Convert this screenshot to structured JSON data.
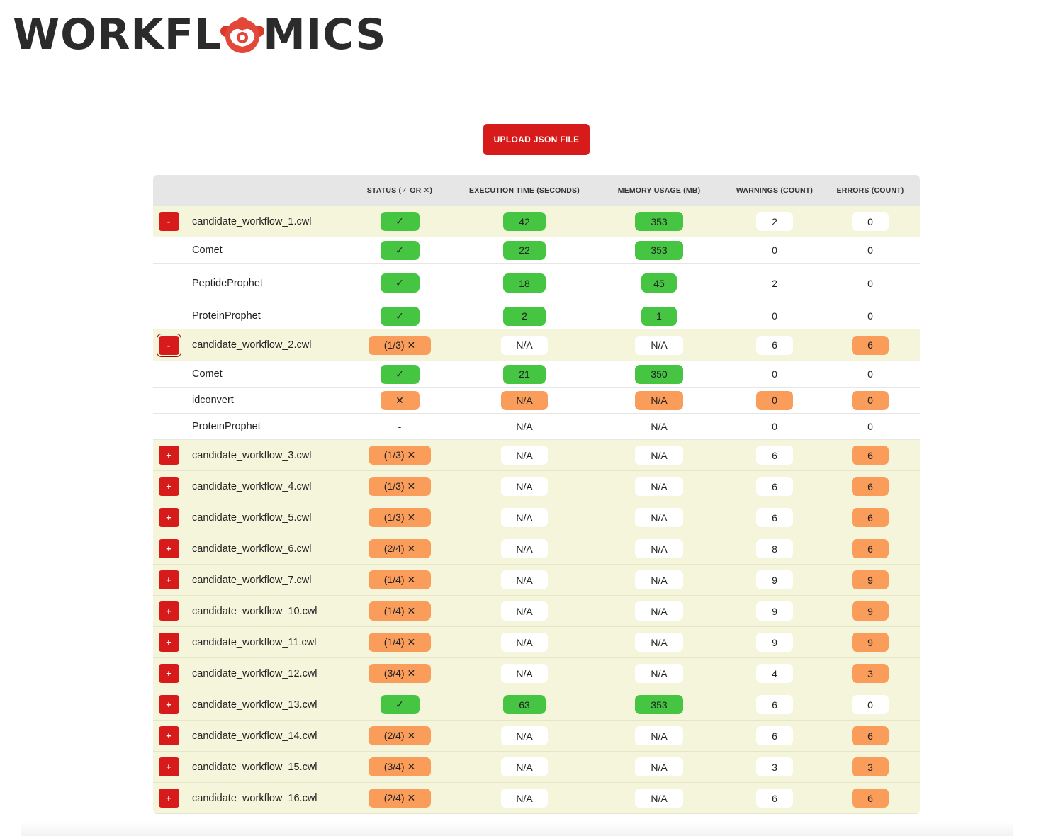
{
  "logo": {
    "text_left": "WORKFL",
    "text_right": "MICS",
    "icon": "monkey-o-icon"
  },
  "upload_button": {
    "label": "UPLOAD JSON FILE"
  },
  "table": {
    "headers": {
      "name": "",
      "status": "STATUS (✓ OR ✕)",
      "execution_time": "EXECUTION TIME (SECONDS)",
      "memory_usage": "MEMORY USAGE (MB)",
      "warnings": "WARNINGS (COUNT)",
      "errors": "ERRORS (COUNT)"
    },
    "rows": [
      {
        "kind": "workflow",
        "toggle": "-",
        "name": "candidate_workflow_1.cwl",
        "status": "✓",
        "exec": "42",
        "mem": "353",
        "warn": "2",
        "err": "0"
      },
      {
        "kind": "step",
        "name": "Comet",
        "status": "✓",
        "exec": "22",
        "mem": "353",
        "warn": "0",
        "err": "0"
      },
      {
        "kind": "step",
        "name": "PeptideProphet",
        "status": "✓",
        "exec": "18",
        "mem": "45",
        "warn": "2",
        "err": "0"
      },
      {
        "kind": "step",
        "name": "ProteinProphet",
        "status": "✓",
        "exec": "2",
        "mem": "1",
        "warn": "0",
        "err": "0"
      },
      {
        "kind": "workflow",
        "toggle": "-",
        "name": "candidate_workflow_2.cwl",
        "status": "(1/3) ✕",
        "exec": "N/A",
        "mem": "N/A",
        "warn": "6",
        "err": "6"
      },
      {
        "kind": "step",
        "name": "Comet",
        "status": "✓",
        "exec": "21",
        "mem": "350",
        "warn": "0",
        "err": "0"
      },
      {
        "kind": "step",
        "name": "idconvert",
        "status": "✕",
        "exec": "N/A",
        "mem": "N/A",
        "warn": "0",
        "err": "0"
      },
      {
        "kind": "step",
        "name": "ProteinProphet",
        "status": "-",
        "exec": "N/A",
        "mem": "N/A",
        "warn": "0",
        "err": "0"
      },
      {
        "kind": "workflow",
        "toggle": "+",
        "name": "candidate_workflow_3.cwl",
        "status": "(1/3) ✕",
        "exec": "N/A",
        "mem": "N/A",
        "warn": "6",
        "err": "6"
      },
      {
        "kind": "workflow",
        "toggle": "+",
        "name": "candidate_workflow_4.cwl",
        "status": "(1/3) ✕",
        "exec": "N/A",
        "mem": "N/A",
        "warn": "6",
        "err": "6"
      },
      {
        "kind": "workflow",
        "toggle": "+",
        "name": "candidate_workflow_5.cwl",
        "status": "(1/3) ✕",
        "exec": "N/A",
        "mem": "N/A",
        "warn": "6",
        "err": "6"
      },
      {
        "kind": "workflow",
        "toggle": "+",
        "name": "candidate_workflow_6.cwl",
        "status": "(2/4) ✕",
        "exec": "N/A",
        "mem": "N/A",
        "warn": "8",
        "err": "6"
      },
      {
        "kind": "workflow",
        "toggle": "+",
        "name": "candidate_workflow_7.cwl",
        "status": "(1/4) ✕",
        "exec": "N/A",
        "mem": "N/A",
        "warn": "9",
        "err": "9"
      },
      {
        "kind": "workflow",
        "toggle": "+",
        "name": "candidate_workflow_10.cwl",
        "status": "(1/4) ✕",
        "exec": "N/A",
        "mem": "N/A",
        "warn": "9",
        "err": "9"
      },
      {
        "kind": "workflow",
        "toggle": "+",
        "name": "candidate_workflow_11.cwl",
        "status": "(1/4) ✕",
        "exec": "N/A",
        "mem": "N/A",
        "warn": "9",
        "err": "9"
      },
      {
        "kind": "workflow",
        "toggle": "+",
        "name": "candidate_workflow_12.cwl",
        "status": "(3/4) ✕",
        "exec": "N/A",
        "mem": "N/A",
        "warn": "4",
        "err": "3"
      },
      {
        "kind": "workflow",
        "toggle": "+",
        "name": "candidate_workflow_13.cwl",
        "status": "✓",
        "exec": "63",
        "mem": "353",
        "warn": "6",
        "err": "0"
      },
      {
        "kind": "workflow",
        "toggle": "+",
        "name": "candidate_workflow_14.cwl",
        "status": "(2/4) ✕",
        "exec": "N/A",
        "mem": "N/A",
        "warn": "6",
        "err": "6"
      },
      {
        "kind": "workflow",
        "toggle": "+",
        "name": "candidate_workflow_15.cwl",
        "status": "(3/4) ✕",
        "exec": "N/A",
        "mem": "N/A",
        "warn": "3",
        "err": "3"
      },
      {
        "kind": "workflow",
        "toggle": "+",
        "name": "candidate_workflow_16.cwl",
        "status": "(2/4) ✕",
        "exec": "N/A",
        "mem": "N/A",
        "warn": "6",
        "err": "6"
      }
    ]
  },
  "colors": {
    "accent_red": "#d71a1a",
    "success_green": "#46c542",
    "failure_orange": "#fa9d5a",
    "workflow_row_bg": "#f5f5dc"
  }
}
